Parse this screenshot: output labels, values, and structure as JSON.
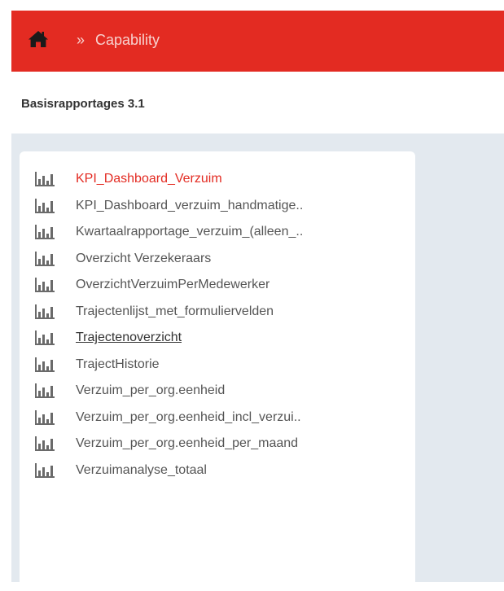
{
  "header": {
    "home_icon": "home-icon",
    "separator": "»",
    "breadcrumb": "Capability",
    "color": "#e32b22"
  },
  "section": {
    "title": "Basisrapportages 3.1"
  },
  "reports": {
    "icon": "bar-chart-icon",
    "items": [
      {
        "label": "KPI_Dashboard_Verzuim",
        "state": "active"
      },
      {
        "label": "KPI_Dashboard_verzuim_handmatige..",
        "state": ""
      },
      {
        "label": "Kwartaalrapportage_verzuim_(alleen_..",
        "state": ""
      },
      {
        "label": "Overzicht Verzekeraars",
        "state": ""
      },
      {
        "label": "OverzichtVerzuimPerMedewerker",
        "state": ""
      },
      {
        "label": "Trajectenlijst_met_formuliervelden",
        "state": ""
      },
      {
        "label": "Trajectenoverzicht",
        "state": "hovered"
      },
      {
        "label": "TrajectHistorie",
        "state": ""
      },
      {
        "label": "Verzuim_per_org.eenheid",
        "state": ""
      },
      {
        "label": "Verzuim_per_org.eenheid_incl_verzui..",
        "state": ""
      },
      {
        "label": "Verzuim_per_org.eenheid_per_maand",
        "state": ""
      },
      {
        "label": "Verzuimanalyse_totaal",
        "state": ""
      }
    ]
  }
}
